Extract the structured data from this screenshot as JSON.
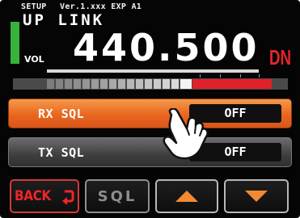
{
  "status": {
    "mode": "SETUP",
    "version": "Ver.1.xxx EXP A1"
  },
  "display": {
    "band_name": "UP LINK",
    "vol_label": "VOL",
    "frequency": "440.500",
    "shift": "DN"
  },
  "meter": {
    "level_fraction": 0.94
  },
  "menu": [
    {
      "label": "RX SQL",
      "value": "OFF",
      "selected": true
    },
    {
      "label": "TX SQL",
      "value": "OFF",
      "selected": false
    }
  ],
  "softkeys": {
    "back": "BACK",
    "sql": "SQL",
    "up": "up-arrow-icon",
    "down": "down-arrow-icon"
  },
  "colors": {
    "selected_row": "#e9661f",
    "shift_text": "#e8242b",
    "level_bar": "#37b23a",
    "meter_red": "#e0202a"
  }
}
